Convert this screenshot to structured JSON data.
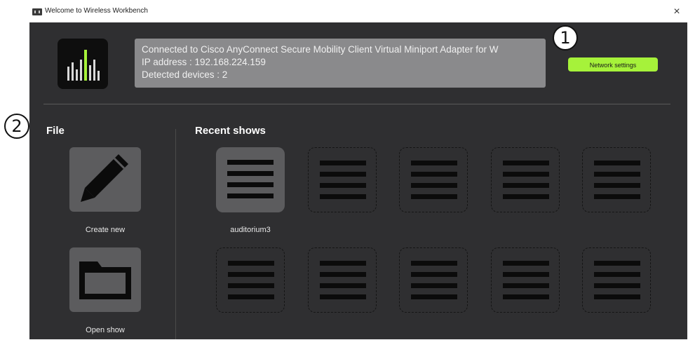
{
  "window": {
    "title": "Welcome to Wireless Workbench",
    "close_glyph": "×"
  },
  "icons": {
    "app": "wireless-workbench-logo-icon",
    "close": "close-icon",
    "create": "pencil-icon",
    "open": "folder-icon",
    "show": "show-list-icon"
  },
  "colors": {
    "accent": "#a6f23a",
    "panel_bg": "#2f2f31",
    "info_bg": "#8a8a8c",
    "tile_bg": "#5c5c5e"
  },
  "connection": {
    "line1": "Connected to Cisco AnyConnect Secure Mobility Client Virtual Miniport Adapter for W",
    "line2": "IP address : 192.168.224.159",
    "line3": "Detected devices : 2"
  },
  "network_settings_label": "Network settings",
  "callouts": {
    "one": "1",
    "two": "2"
  },
  "file_section": {
    "title": "File",
    "create_label": "Create new",
    "open_label": "Open show"
  },
  "recent_section": {
    "title": "Recent shows",
    "shows": [
      {
        "name": "auditorium3",
        "state": "filled"
      },
      {
        "name": "",
        "state": "empty"
      },
      {
        "name": "",
        "state": "empty"
      },
      {
        "name": "",
        "state": "empty"
      },
      {
        "name": "",
        "state": "empty"
      },
      {
        "name": "",
        "state": "empty"
      },
      {
        "name": "",
        "state": "empty"
      },
      {
        "name": "",
        "state": "empty"
      },
      {
        "name": "",
        "state": "empty"
      },
      {
        "name": "",
        "state": "empty"
      }
    ]
  }
}
